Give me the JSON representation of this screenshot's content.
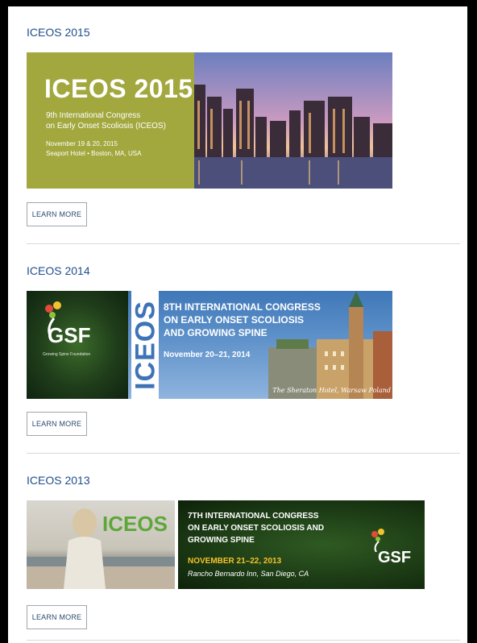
{
  "events": [
    {
      "title": "ICEOS 2015",
      "banner": {
        "headline": "ICEOS 2015",
        "subtitle_line1": "9th International Congress",
        "subtitle_line2": "on Early Onset Scoliosis (ICEOS)",
        "date": "November 19 & 20, 2015",
        "location": "Seaport Hotel • Boston, MA, USA"
      },
      "button": "LEARN MORE"
    },
    {
      "title": "ICEOS 2014",
      "banner": {
        "logo_text": "GSF",
        "logo_sub": "Growing Spine Foundation",
        "vertical_text": "ICEOS",
        "line1": "8TH INTERNATIONAL CONGRESS",
        "line2": "ON EARLY ONSET SCOLIOSIS",
        "line3": "AND GROWING SPINE",
        "date": "November 20–21, 2014",
        "location": "The Sheraton Hotel, Warsaw Poland"
      },
      "button": "LEARN MORE"
    },
    {
      "title": "ICEOS 2013",
      "banner": {
        "brand": "ICEOS",
        "line1": "7TH INTERNATIONAL CONGRESS",
        "line2": "ON EARLY ONSET SCOLIOSIS AND",
        "line3": "GROWING SPINE",
        "date": "NOVEMBER 21–22, 2013",
        "location": "Rancho Bernardo Inn, San Diego, CA",
        "logo_text": "GSF"
      },
      "button": "LEARN MORE"
    }
  ]
}
